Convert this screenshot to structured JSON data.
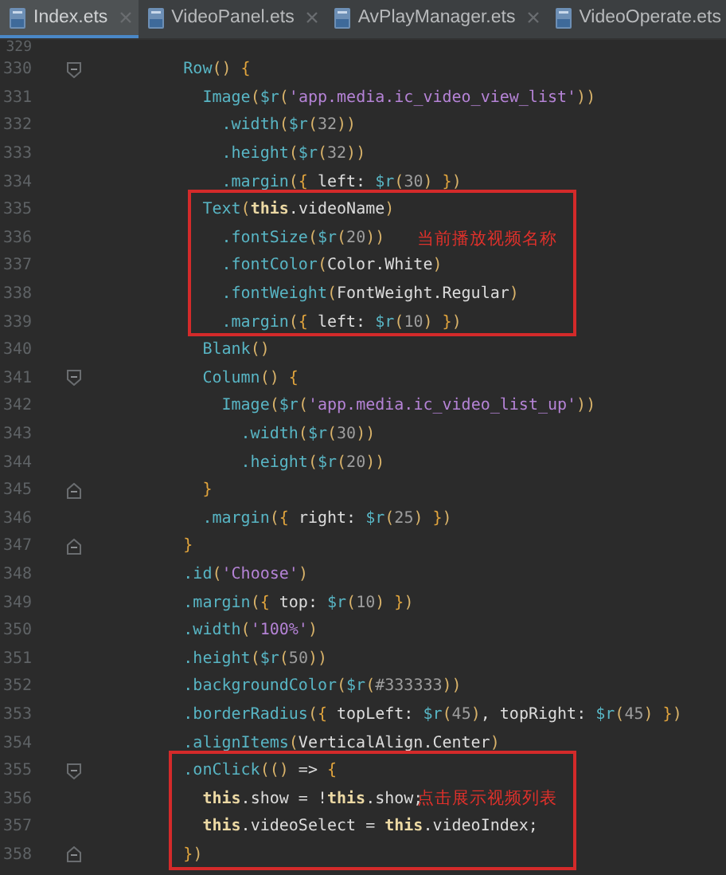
{
  "tabs": [
    {
      "label": "Index.ets",
      "selected": true,
      "closable": true
    },
    {
      "label": "VideoPanel.ets",
      "selected": false,
      "closable": true
    },
    {
      "label": "AvPlayManager.ets",
      "selected": false,
      "closable": true
    },
    {
      "label": "VideoOperate.ets",
      "selected": false,
      "closable": false
    }
  ],
  "editor": {
    "lines": [
      {
        "number": "329",
        "fold_start": false,
        "fold_end": false,
        "boxed": false
      },
      {
        "number": "330",
        "fold_start": true,
        "fold_end": false,
        "boxed": false,
        "tokens": [
          {
            "kind": "call",
            "text": "        Row"
          },
          {
            "kind": "paren",
            "text": "() "
          },
          {
            "kind": "brace",
            "text": "{"
          }
        ]
      },
      {
        "number": "331",
        "fold_start": false,
        "fold_end": false,
        "boxed": false,
        "tokens": [
          {
            "kind": "call",
            "text": "          Image"
          },
          {
            "kind": "paren",
            "text": "("
          },
          {
            "kind": "call",
            "text": "$r"
          },
          {
            "kind": "paren",
            "text": "("
          },
          {
            "kind": "str",
            "text": "'app.media.ic_video_view_list'"
          },
          {
            "kind": "paren",
            "text": "))"
          }
        ]
      },
      {
        "number": "332",
        "fold_start": false,
        "fold_end": false,
        "boxed": false,
        "tokens": [
          {
            "kind": "call",
            "text": "            .width"
          },
          {
            "kind": "paren",
            "text": "("
          },
          {
            "kind": "call",
            "text": "$r"
          },
          {
            "kind": "paren",
            "text": "("
          },
          {
            "kind": "num",
            "text": "32"
          },
          {
            "kind": "paren",
            "text": "))"
          }
        ]
      },
      {
        "number": "333",
        "fold_start": false,
        "fold_end": false,
        "boxed": false,
        "tokens": [
          {
            "kind": "call",
            "text": "            .height"
          },
          {
            "kind": "paren",
            "text": "("
          },
          {
            "kind": "call",
            "text": "$r"
          },
          {
            "kind": "paren",
            "text": "("
          },
          {
            "kind": "num",
            "text": "32"
          },
          {
            "kind": "paren",
            "text": "))"
          }
        ]
      },
      {
        "number": "334",
        "fold_start": false,
        "fold_end": false,
        "boxed": false,
        "tokens": [
          {
            "kind": "call",
            "text": "            .margin"
          },
          {
            "kind": "paren",
            "text": "("
          },
          {
            "kind": "brace",
            "text": "{"
          },
          {
            "kind": "plain",
            "text": " left: "
          },
          {
            "kind": "call",
            "text": "$r"
          },
          {
            "kind": "paren",
            "text": "("
          },
          {
            "kind": "num",
            "text": "30"
          },
          {
            "kind": "paren",
            "text": ") "
          },
          {
            "kind": "brace",
            "text": "}"
          },
          {
            "kind": "paren",
            "text": ")"
          }
        ]
      },
      {
        "number": "335",
        "fold_start": false,
        "fold_end": false,
        "boxed": true,
        "tokens": [
          {
            "kind": "call",
            "text": "          Text"
          },
          {
            "kind": "paren",
            "text": "("
          },
          {
            "kind": "kw",
            "text": "this"
          },
          {
            "kind": "plain",
            "text": ".videoName"
          },
          {
            "kind": "paren",
            "text": ")"
          }
        ]
      },
      {
        "number": "336",
        "fold_start": false,
        "fold_end": false,
        "boxed": true,
        "note": "当前播放视频名称",
        "tokens": [
          {
            "kind": "call",
            "text": "            .fontSize"
          },
          {
            "kind": "paren",
            "text": "("
          },
          {
            "kind": "call",
            "text": "$r"
          },
          {
            "kind": "paren",
            "text": "("
          },
          {
            "kind": "num",
            "text": "20"
          },
          {
            "kind": "paren",
            "text": "))"
          }
        ]
      },
      {
        "number": "337",
        "fold_start": false,
        "fold_end": false,
        "boxed": true,
        "tokens": [
          {
            "kind": "call",
            "text": "            .fontColor"
          },
          {
            "kind": "paren",
            "text": "("
          },
          {
            "kind": "plain",
            "text": "Color.White"
          },
          {
            "kind": "paren",
            "text": ")"
          }
        ]
      },
      {
        "number": "338",
        "fold_start": false,
        "fold_end": false,
        "boxed": true,
        "tokens": [
          {
            "kind": "call",
            "text": "            .fontWeight"
          },
          {
            "kind": "paren",
            "text": "("
          },
          {
            "kind": "plain",
            "text": "FontWeight.Regular"
          },
          {
            "kind": "paren",
            "text": ")"
          }
        ]
      },
      {
        "number": "339",
        "fold_start": false,
        "fold_end": false,
        "boxed": true,
        "tokens": [
          {
            "kind": "call",
            "text": "            .margin"
          },
          {
            "kind": "paren",
            "text": "("
          },
          {
            "kind": "brace",
            "text": "{"
          },
          {
            "kind": "plain",
            "text": " left: "
          },
          {
            "kind": "call",
            "text": "$r"
          },
          {
            "kind": "paren",
            "text": "("
          },
          {
            "kind": "num",
            "text": "10"
          },
          {
            "kind": "paren",
            "text": ") "
          },
          {
            "kind": "brace",
            "text": "}"
          },
          {
            "kind": "paren",
            "text": ")"
          }
        ]
      },
      {
        "number": "340",
        "fold_start": false,
        "fold_end": false,
        "boxed": false,
        "tokens": [
          {
            "kind": "call",
            "text": "          Blank"
          },
          {
            "kind": "paren",
            "text": "()"
          }
        ]
      },
      {
        "number": "341",
        "fold_start": true,
        "fold_end": false,
        "boxed": false,
        "tokens": [
          {
            "kind": "call",
            "text": "          Column"
          },
          {
            "kind": "paren",
            "text": "() "
          },
          {
            "kind": "brace",
            "text": "{"
          }
        ]
      },
      {
        "number": "342",
        "fold_start": false,
        "fold_end": false,
        "boxed": false,
        "tokens": [
          {
            "kind": "call",
            "text": "            Image"
          },
          {
            "kind": "paren",
            "text": "("
          },
          {
            "kind": "call",
            "text": "$r"
          },
          {
            "kind": "paren",
            "text": "("
          },
          {
            "kind": "str",
            "text": "'app.media.ic_video_list_up'"
          },
          {
            "kind": "paren",
            "text": "))"
          }
        ]
      },
      {
        "number": "343",
        "fold_start": false,
        "fold_end": false,
        "boxed": false,
        "tokens": [
          {
            "kind": "call",
            "text": "              .width"
          },
          {
            "kind": "paren",
            "text": "("
          },
          {
            "kind": "call",
            "text": "$r"
          },
          {
            "kind": "paren",
            "text": "("
          },
          {
            "kind": "num",
            "text": "30"
          },
          {
            "kind": "paren",
            "text": "))"
          }
        ]
      },
      {
        "number": "344",
        "fold_start": false,
        "fold_end": false,
        "boxed": false,
        "tokens": [
          {
            "kind": "call",
            "text": "              .height"
          },
          {
            "kind": "paren",
            "text": "("
          },
          {
            "kind": "call",
            "text": "$r"
          },
          {
            "kind": "paren",
            "text": "("
          },
          {
            "kind": "num",
            "text": "20"
          },
          {
            "kind": "paren",
            "text": "))"
          }
        ]
      },
      {
        "number": "345",
        "fold_start": false,
        "fold_end": true,
        "boxed": false,
        "tokens": [
          {
            "kind": "brace",
            "text": "          }"
          }
        ]
      },
      {
        "number": "346",
        "fold_start": false,
        "fold_end": false,
        "boxed": false,
        "tokens": [
          {
            "kind": "call",
            "text": "          .margin"
          },
          {
            "kind": "paren",
            "text": "("
          },
          {
            "kind": "brace",
            "text": "{"
          },
          {
            "kind": "plain",
            "text": " right: "
          },
          {
            "kind": "call",
            "text": "$r"
          },
          {
            "kind": "paren",
            "text": "("
          },
          {
            "kind": "num",
            "text": "25"
          },
          {
            "kind": "paren",
            "text": ") "
          },
          {
            "kind": "brace",
            "text": "}"
          },
          {
            "kind": "paren",
            "text": ")"
          }
        ]
      },
      {
        "number": "347",
        "fold_start": false,
        "fold_end": true,
        "boxed": false,
        "tokens": [
          {
            "kind": "brace",
            "text": "        }"
          }
        ]
      },
      {
        "number": "348",
        "fold_start": false,
        "fold_end": false,
        "boxed": false,
        "tokens": [
          {
            "kind": "call",
            "text": "        .id"
          },
          {
            "kind": "paren",
            "text": "("
          },
          {
            "kind": "str",
            "text": "'Choose'"
          },
          {
            "kind": "paren",
            "text": ")"
          }
        ]
      },
      {
        "number": "349",
        "fold_start": false,
        "fold_end": false,
        "boxed": false,
        "tokens": [
          {
            "kind": "call",
            "text": "        .margin"
          },
          {
            "kind": "paren",
            "text": "("
          },
          {
            "kind": "brace",
            "text": "{"
          },
          {
            "kind": "plain",
            "text": " top: "
          },
          {
            "kind": "call",
            "text": "$r"
          },
          {
            "kind": "paren",
            "text": "("
          },
          {
            "kind": "num",
            "text": "10"
          },
          {
            "kind": "paren",
            "text": ") "
          },
          {
            "kind": "brace",
            "text": "}"
          },
          {
            "kind": "paren",
            "text": ")"
          }
        ]
      },
      {
        "number": "350",
        "fold_start": false,
        "fold_end": false,
        "boxed": false,
        "tokens": [
          {
            "kind": "call",
            "text": "        .width"
          },
          {
            "kind": "paren",
            "text": "("
          },
          {
            "kind": "str",
            "text": "'100%'"
          },
          {
            "kind": "paren",
            "text": ")"
          }
        ]
      },
      {
        "number": "351",
        "fold_start": false,
        "fold_end": false,
        "boxed": false,
        "tokens": [
          {
            "kind": "call",
            "text": "        .height"
          },
          {
            "kind": "paren",
            "text": "("
          },
          {
            "kind": "call",
            "text": "$r"
          },
          {
            "kind": "paren",
            "text": "("
          },
          {
            "kind": "num",
            "text": "50"
          },
          {
            "kind": "paren",
            "text": "))"
          }
        ]
      },
      {
        "number": "352",
        "fold_start": false,
        "fold_end": false,
        "boxed": false,
        "tokens": [
          {
            "kind": "call",
            "text": "        .backgroundColor"
          },
          {
            "kind": "paren",
            "text": "("
          },
          {
            "kind": "call",
            "text": "$r"
          },
          {
            "kind": "paren",
            "text": "("
          },
          {
            "kind": "num",
            "text": "#333333"
          },
          {
            "kind": "paren",
            "text": "))"
          }
        ]
      },
      {
        "number": "353",
        "fold_start": false,
        "fold_end": false,
        "boxed": false,
        "tokens": [
          {
            "kind": "call",
            "text": "        .borderRadius"
          },
          {
            "kind": "paren",
            "text": "("
          },
          {
            "kind": "brace",
            "text": "{"
          },
          {
            "kind": "plain",
            "text": " topLeft: "
          },
          {
            "kind": "call",
            "text": "$r"
          },
          {
            "kind": "paren",
            "text": "("
          },
          {
            "kind": "num",
            "text": "45"
          },
          {
            "kind": "paren",
            "text": ")"
          },
          {
            "kind": "plain",
            "text": ", topRight: "
          },
          {
            "kind": "call",
            "text": "$r"
          },
          {
            "kind": "paren",
            "text": "("
          },
          {
            "kind": "num",
            "text": "45"
          },
          {
            "kind": "paren",
            "text": ") "
          },
          {
            "kind": "brace",
            "text": "}"
          },
          {
            "kind": "paren",
            "text": ")"
          }
        ]
      },
      {
        "number": "354",
        "fold_start": false,
        "fold_end": false,
        "boxed": false,
        "tokens": [
          {
            "kind": "call",
            "text": "        .alignItems"
          },
          {
            "kind": "paren",
            "text": "("
          },
          {
            "kind": "plain",
            "text": "VerticalAlign.Center"
          },
          {
            "kind": "paren",
            "text": ")"
          }
        ]
      },
      {
        "number": "355",
        "fold_start": true,
        "fold_end": false,
        "boxed": true,
        "tokens": [
          {
            "kind": "call",
            "text": "        .onClick"
          },
          {
            "kind": "paren",
            "text": "(() "
          },
          {
            "kind": "plain",
            "text": "=> "
          },
          {
            "kind": "brace",
            "text": "{"
          }
        ]
      },
      {
        "number": "356",
        "fold_start": false,
        "fold_end": false,
        "boxed": true,
        "note": "点击展示视频列表",
        "tokens": [
          {
            "kind": "kw",
            "text": "          this"
          },
          {
            "kind": "plain",
            "text": ".show = !"
          },
          {
            "kind": "kw",
            "text": "this"
          },
          {
            "kind": "plain",
            "text": ".show;"
          }
        ]
      },
      {
        "number": "357",
        "fold_start": false,
        "fold_end": false,
        "boxed": true,
        "tokens": [
          {
            "kind": "kw",
            "text": "          this"
          },
          {
            "kind": "plain",
            "text": ".videoSelect = "
          },
          {
            "kind": "kw",
            "text": "this"
          },
          {
            "kind": "plain",
            "text": ".videoIndex;"
          }
        ]
      },
      {
        "number": "358",
        "fold_start": false,
        "fold_end": true,
        "boxed": true,
        "tokens": [
          {
            "kind": "brace",
            "text": "        }"
          },
          {
            "kind": "paren",
            "text": ")"
          }
        ]
      }
    ]
  }
}
